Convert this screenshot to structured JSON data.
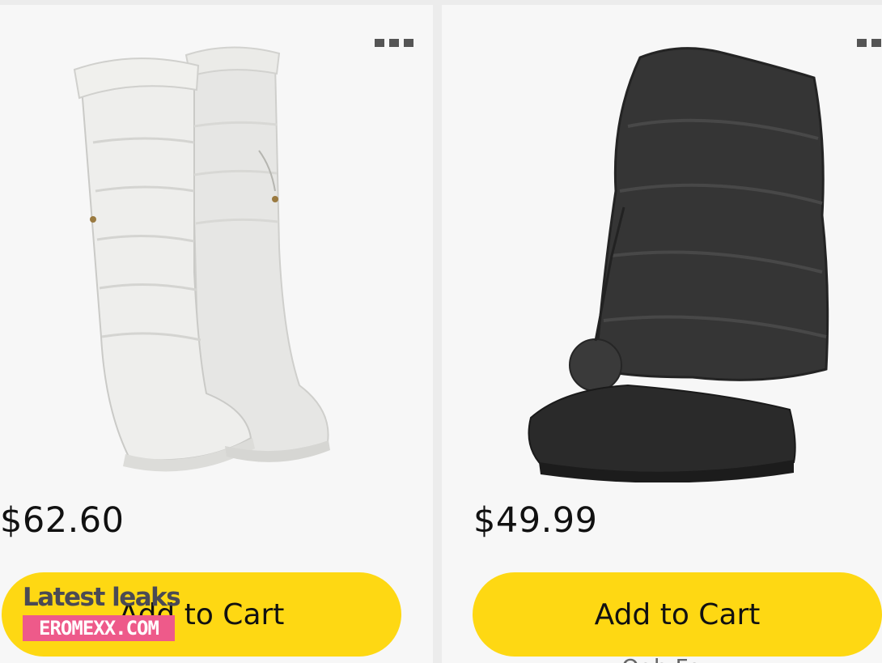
{
  "products": [
    {
      "price": "$62.60",
      "cart_label": "Add to Cart",
      "image_icon": "white-quilted-boot-image",
      "more_icon": "more-options-icon"
    },
    {
      "price": "$49.99",
      "cart_label": "Add to Cart",
      "image_icon": "black-fur-boot-image",
      "more_icon": "more-options-icon",
      "below_text": "Ogh Fo..."
    }
  ],
  "watermark": {
    "title": "Latest leaks",
    "site": "EROMEXX.COM"
  },
  "colors": {
    "button": "#fed813",
    "card_bg": "#f7f7f7",
    "page_bg": "#ececec",
    "watermark_pink": "#ee5a8a"
  }
}
